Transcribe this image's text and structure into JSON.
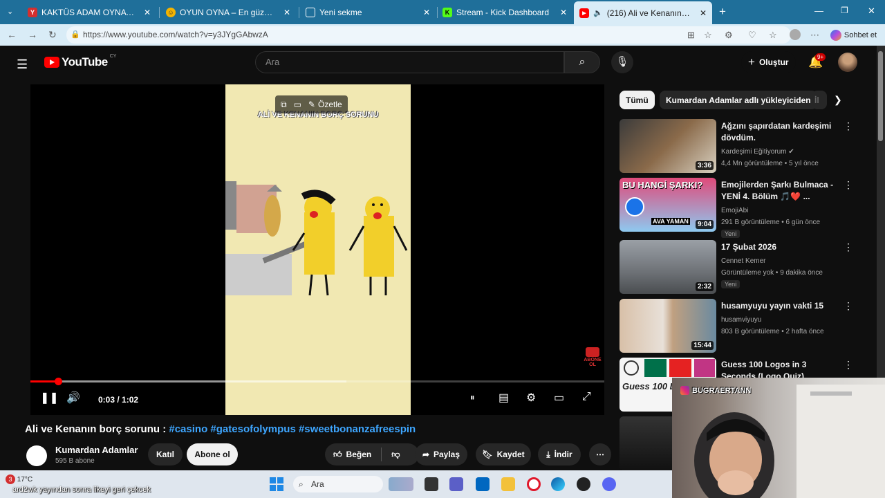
{
  "browser": {
    "tabs": [
      {
        "label": "KAKTÜS ADAM OYNA — Yandex",
        "fav": "Y",
        "fav_color": "#d32f2f"
      },
      {
        "label": "OYUN OYNA – En güzel oyunlar M",
        "fav": "☺",
        "fav_color": "#f5b400"
      },
      {
        "label": "Yeni sekme",
        "fav": "▢",
        "fav_color": "#5a8fb3"
      },
      {
        "label": "Stream - Kick Dashboard",
        "fav": "K",
        "fav_color": "#53fc18"
      },
      {
        "label": "(216) Ali ve Kenanın borç soru",
        "fav": "▶",
        "fav_color": "#ff0000"
      }
    ],
    "url": "https://www.youtube.com/watch?v=y3JYgGAbwzA",
    "sohbet_label": "Sohbet et"
  },
  "header": {
    "logo_text": "YouTube",
    "country_code": "CY",
    "search_placeholder": "Ara",
    "create_label": "Oluştur",
    "notif_badge": "9+"
  },
  "player": {
    "video_overlay_title": "ALİ VE KENANIN BORÇ SORUNU",
    "summarize_label": "Özetle",
    "time_display": "0:03 / 1:02",
    "progress": 0.048,
    "buffered": 0.55,
    "subscribe_badge": "ABONE OL"
  },
  "video": {
    "title_plain": "Ali ve Kenanın borç sorunu :",
    "hashtags": [
      "#casino",
      "#gatesofolympus",
      "#sweetbonanzafreespin"
    ],
    "channel_name": "Kumardan Adamlar",
    "channel_subs": "595 B abone",
    "join_label": "Katıl",
    "subscribe_label": "Abone ol",
    "like_label": "Beğen",
    "share_label": "Paylaş",
    "save_label": "Kaydet",
    "download_label": "İndir"
  },
  "sidebar": {
    "chips": [
      "Tümü",
      "Kumardan Adamlar adlı yükleyiciden",
      "İl"
    ],
    "recs": [
      {
        "title": "Ağzını şapırdatan kardeşimi dövdüm.",
        "channel": "Kardeşimi Eğitiyorum",
        "verified": true,
        "meta": "4,4 Mn görüntüleme • 5 yıl önce",
        "duration": "3:36",
        "new": ""
      },
      {
        "title": "Emojilerden Şarkı Bulmaca - YENİ 4. Bölüm 🎵❤️ ...",
        "channel": "EmojiAbi",
        "verified": false,
        "meta": "291 B görüntüleme • 6 gün önce",
        "duration": "9:04",
        "new": "Yeni",
        "thumb_text": "BU HANGİ ŞARKI?",
        "thumb_sub": "AVA YAMAN"
      },
      {
        "title": "17 Şubat 2026",
        "channel": "Cennet Kemer",
        "verified": false,
        "meta": "Görüntüleme yok • 9 dakika önce",
        "duration": "2:32",
        "new": "Yeni"
      },
      {
        "title": "husamyuyu yayın vakti 15",
        "channel": "husamviyuyu",
        "verified": false,
        "meta": "803 B görüntüleme • 2 hafta önce",
        "duration": "15:44",
        "new": ""
      },
      {
        "title": "Guess 100 Logos in 3 Seconds (Logo Quiz)",
        "channel": "",
        "verified": false,
        "meta": "",
        "duration": "",
        "new": "",
        "thumb_text": "Guess 100 L"
      }
    ]
  },
  "taskbar": {
    "weather": "17°C",
    "ticker": "ard2wk yayından sonra likeyi geri çekcek",
    "search_label": "Ara",
    "notif_count": "3"
  },
  "webcam": {
    "handle": "BUGRAERTANN"
  },
  "colors": {
    "yt_red": "#ff0000",
    "link_blue": "#3ea6ff",
    "bg": "#0f0f0f",
    "tabbar": "#1f6f9a"
  }
}
